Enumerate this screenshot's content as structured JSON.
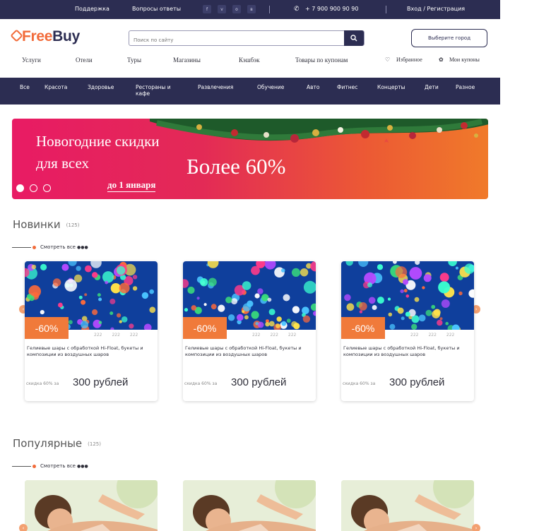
{
  "topbar": {
    "links": [
      "Поддержка",
      "Вопросы ответы"
    ],
    "social": [
      "f",
      "v",
      "o",
      "в"
    ],
    "phone": "+ 7 900 900 90 90",
    "auth": "Вход / Регистрация"
  },
  "header": {
    "logo_a": "Free",
    "logo_b": "Buy",
    "search_placeholder": "Поиск по сайту",
    "city_button": "Выберите город"
  },
  "mainnav": {
    "items": [
      "Услуги",
      "Отели",
      "Туры",
      "Магазины",
      "Кэшбэк",
      "Товары по купонам"
    ],
    "favorites": "Избранное",
    "coupons": "Мои купоны"
  },
  "categories": [
    "Все",
    "Красота",
    "Здоровье",
    "Рестораны и кафе",
    "Развлечения",
    "Обучение",
    "Авто",
    "Фитнес",
    "Концерты",
    "Дети",
    "Разное"
  ],
  "banner": {
    "line1": "Новогодние скидки",
    "line2": "для всех",
    "big": "Более 60%",
    "until": "до 1 января"
  },
  "sections": [
    {
      "title": "Новинки",
      "count": "(125)",
      "see_all": "Смотреть все",
      "cards": [
        {
          "discount": "-60%",
          "meta": [
            "222",
            "222",
            "222"
          ],
          "desc": "Гелиевые шары с обработкой Hi-Float, букеты и композиции из воздушных шаров",
          "old": "скидка 60% за",
          "price": "300 рублей"
        },
        {
          "discount": "-60%",
          "meta": [
            "222",
            "222",
            "222"
          ],
          "desc": "Гелиевые шары с обработкой Hi-Float, букеты и композиции из воздушных шаров",
          "old": "скидка 60% за",
          "price": "300 рублей"
        },
        {
          "discount": "-60%",
          "meta": [
            "222",
            "222",
            "222"
          ],
          "desc": "Гелиевые шары с обработкой Hi-Float, букеты и композиции из воздушных шаров",
          "old": "скидка 60% за",
          "price": "300 рублей"
        }
      ]
    },
    {
      "title": "Популярные",
      "count": "(125)",
      "see_all": "Смотреть все"
    }
  ],
  "colors": {
    "navy": "#2c2d52",
    "accent": "#f26b3a",
    "banner_from": "#e81b64",
    "banner_to": "#f07a2a"
  }
}
